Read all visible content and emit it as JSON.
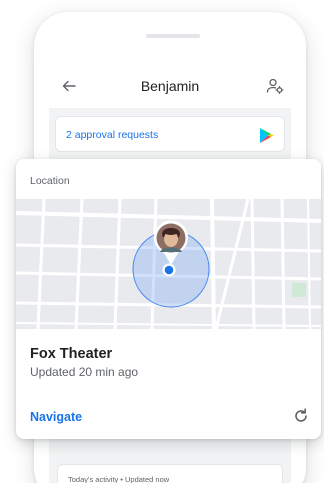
{
  "appbar": {
    "title": "Benjamin",
    "back_icon": "arrow-back-icon",
    "manage_icon": "manage-account-icon"
  },
  "approvals": {
    "label": "2 approval requests",
    "icon": "google-play-icon"
  },
  "location": {
    "heading": "Location",
    "place": "Fox Theater",
    "updated": "Updated 20 min ago",
    "navigate_label": "Navigate",
    "refresh_icon": "refresh-icon",
    "avatar_icon": "avatar-photo",
    "marker_icon": "location-dot-icon"
  },
  "activity": {
    "label": "Today's activity • Updated now"
  },
  "colors": {
    "accent": "#1a73e8",
    "map_land": "#e8eaed",
    "map_road": "#ffffff",
    "accuracy_circle": "#7baaf7"
  }
}
